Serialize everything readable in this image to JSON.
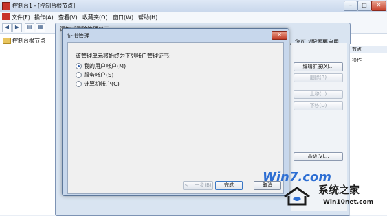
{
  "window": {
    "title": "控制台1 - [控制台根节点]",
    "min_label": "–",
    "max_label": "□",
    "close_label": "✕"
  },
  "menu": [
    "文件(F)",
    "操作(A)",
    "查看(V)",
    "收藏夹(O)",
    "窗口(W)",
    "帮助(H)"
  ],
  "toolbar": {
    "back_icon": "arrow-left-icon",
    "forward_icon": "arrow-right-icon"
  },
  "tree": {
    "root_label": "控制台根节点"
  },
  "snapin_dialog": {
    "title": "添加或删除管理单元",
    "description_fragment": "元，您可以配置要启用",
    "buttons": {
      "edit_extensions": "编辑扩展(X)...",
      "remove": "删除(R)",
      "move_up": "上移(U)",
      "move_down": "下移(D)",
      "advanced": "高级(V)..."
    }
  },
  "actions_panel": {
    "header": "节点",
    "item": "操作"
  },
  "cert_dialog": {
    "title": "证书管理",
    "close_label": "✕",
    "prompt": "该管理单元将始终为下列帐户管理证书:",
    "options": [
      {
        "label": "我的用户帐户(M)",
        "selected": true
      },
      {
        "label": "服务帐户(S)",
        "selected": false
      },
      {
        "label": "计算机帐户(C)",
        "selected": false
      }
    ],
    "buttons": {
      "back": "< 上一步(B)",
      "finish": "完成",
      "cancel": "取消"
    }
  },
  "watermark": {
    "win7": "Win7.com",
    "site_name": "系统之家",
    "url": "Win10net.com",
    "accent_color": "#2d6ed3"
  }
}
